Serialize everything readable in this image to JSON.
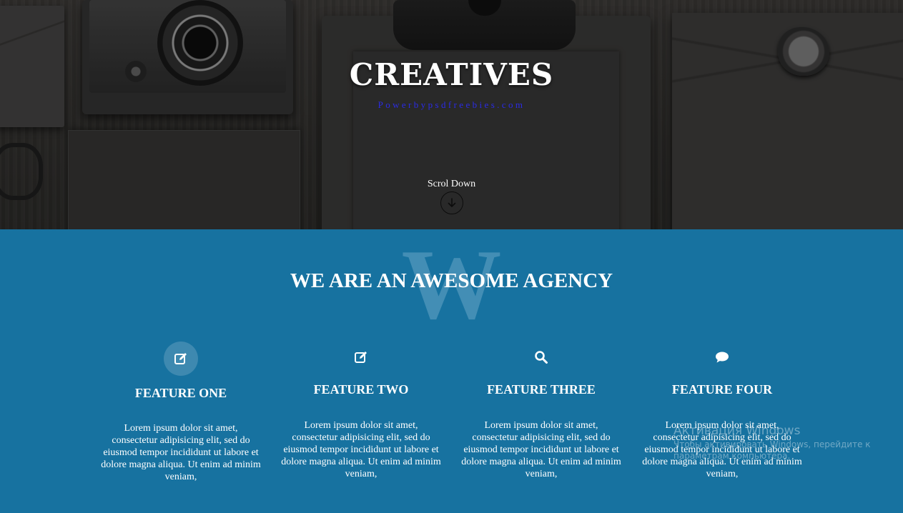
{
  "hero": {
    "title": "CREATIVES",
    "subtitle": "Powerbypsdfreebies.com",
    "subtitle_color": "#2b2be6",
    "scroll_label": "Scrol Down",
    "scroll_icon": "arrow-down-circle-icon"
  },
  "agency": {
    "background_color": "#1772a0",
    "watermark_letter": "W",
    "title": "WE ARE AN AWESOME AGENCY",
    "features": [
      {
        "icon": "edit-icon",
        "title": "FEATURE ONE",
        "text": "Lorem ipsum dolor sit amet, consectetur adipisicing elit, sed do eiusmod tempor incididunt ut labore et dolore magna aliqua. Ut enim ad minim veniam,"
      },
      {
        "icon": "edit-icon",
        "title": "FEATURE TWO",
        "text": "Lorem ipsum dolor sit amet, consectetur adipisicing elit, sed do eiusmod tempor incididunt ut labore et dolore magna aliqua. Ut enim ad minim veniam,"
      },
      {
        "icon": "search-icon",
        "title": "FEATURE THREE",
        "text": "Lorem ipsum dolor sit amet, consectetur adipisicing elit, sed do eiusmod tempor incididunt ut labore et dolore magna aliqua. Ut enim ad minim veniam,"
      },
      {
        "icon": "comment-icon",
        "title": "FEATURE FOUR",
        "text": "Lorem ipsum dolor sit amet, consectetur adipisicing elit, sed do eiusmod tempor incididunt ut labore et dolore magna aliqua. Ut enim ad minim veniam,"
      }
    ]
  },
  "watermark_overlay": {
    "line1": "Активация Windows",
    "line2": "Чтобы активировать Windows, перейдите к",
    "line3": "параметрам компьютера."
  }
}
